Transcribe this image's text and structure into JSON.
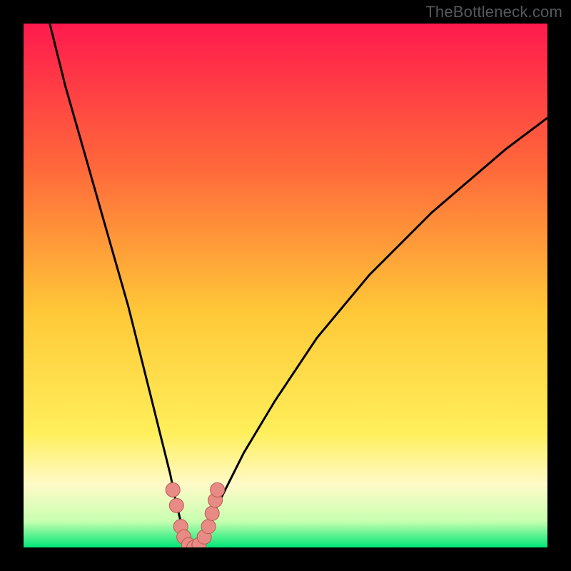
{
  "watermark": "TheBottleneck.com",
  "colors": {
    "black": "#000000",
    "gradient_top": "#ff1a4d",
    "gradient_mid_upper": "#ff7a33",
    "gradient_mid": "#ffd700",
    "gradient_mid_lower": "#ffff66",
    "gradient_cream": "#fff8cc",
    "gradient_green": "#00e676",
    "curve_stroke": "#000000",
    "marker_fill": "#e88b84",
    "marker_stroke": "#b85a52"
  },
  "chart_data": {
    "type": "line",
    "title": "",
    "xlabel": "",
    "ylabel": "",
    "xlim": [
      0,
      100
    ],
    "ylim": [
      0,
      100
    ],
    "series": [
      {
        "name": "bottleneck-curve",
        "x": [
          5,
          8,
          12,
          16,
          20,
          24,
          26,
          28,
          29,
          30,
          31,
          32,
          33,
          34,
          35,
          36,
          38,
          42,
          48,
          56,
          66,
          78,
          92,
          100
        ],
        "y": [
          100,
          88,
          74,
          60,
          46,
          30,
          22,
          14,
          9,
          5,
          2,
          0,
          0,
          1,
          3,
          6,
          10,
          18,
          28,
          40,
          52,
          64,
          76,
          82
        ]
      }
    ],
    "markers": [
      {
        "x": 28.5,
        "y": 11
      },
      {
        "x": 29.2,
        "y": 8
      },
      {
        "x": 30.0,
        "y": 4
      },
      {
        "x": 30.6,
        "y": 2
      },
      {
        "x": 31.5,
        "y": 0.5
      },
      {
        "x": 32.5,
        "y": 0
      },
      {
        "x": 33.5,
        "y": 0.5
      },
      {
        "x": 34.5,
        "y": 2
      },
      {
        "x": 35.3,
        "y": 4
      },
      {
        "x": 36.0,
        "y": 6.5
      },
      {
        "x": 36.6,
        "y": 9
      },
      {
        "x": 37.0,
        "y": 11
      }
    ],
    "marker_radius": 10
  }
}
